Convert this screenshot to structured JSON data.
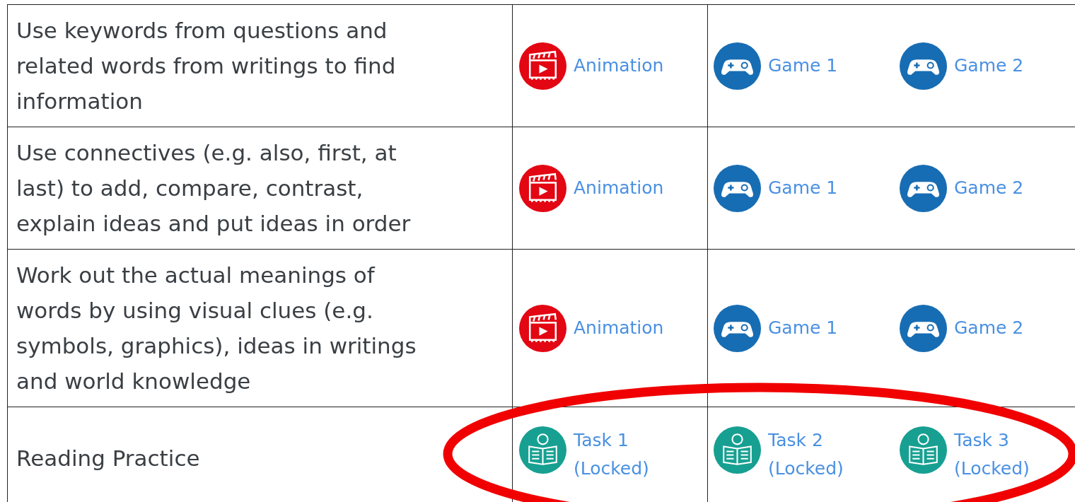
{
  "rows": [
    {
      "description": "Use keywords from questions and related words from writings to find information",
      "cells": [
        [
          {
            "kind": "animation",
            "label": "Animation"
          }
        ],
        [
          {
            "kind": "game",
            "label": "Game 1"
          },
          {
            "kind": "game",
            "label": "Game 2"
          }
        ]
      ]
    },
    {
      "description": "Use connectives (e.g. also, first, at last) to add, compare, contrast, explain ideas and put ideas in order",
      "cells": [
        [
          {
            "kind": "animation",
            "label": "Animation"
          }
        ],
        [
          {
            "kind": "game",
            "label": "Game 1"
          },
          {
            "kind": "game",
            "label": "Game 2"
          }
        ]
      ]
    },
    {
      "description": "Work out the actual meanings of words by using visual clues (e.g. symbols, graphics), ideas in writings and world knowledge",
      "cells": [
        [
          {
            "kind": "animation",
            "label": "Animation"
          }
        ],
        [
          {
            "kind": "game",
            "label": "Game 1"
          },
          {
            "kind": "game",
            "label": "Game 2"
          }
        ]
      ]
    },
    {
      "description": "Reading Practice",
      "cells": [
        [
          {
            "kind": "task",
            "label": "Task 1",
            "note": "(Locked)"
          }
        ],
        [
          {
            "kind": "task",
            "label": "Task 2",
            "note": "(Locked)"
          },
          {
            "kind": "task",
            "label": "Task 3",
            "note": "(Locked)"
          }
        ]
      ]
    }
  ]
}
